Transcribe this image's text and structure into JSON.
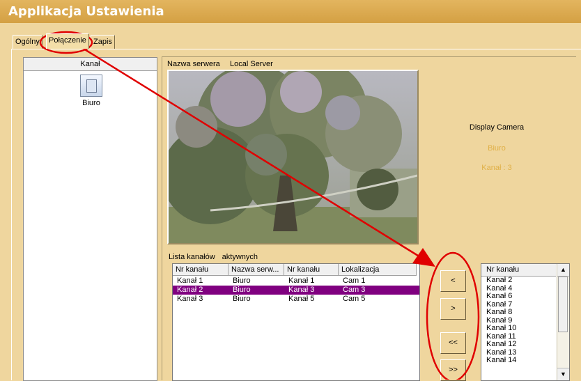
{
  "window": {
    "title": "Applikacja Ustawienia"
  },
  "tabs": [
    {
      "label": "Ogólny"
    },
    {
      "label": "Połączenie",
      "active": true
    },
    {
      "label": "Zapis"
    }
  ],
  "left_panel": {
    "header": "Kanał",
    "servers": [
      {
        "label": "Biuro",
        "icon": "server-icon"
      }
    ]
  },
  "server": {
    "label": "Nazwa serwera",
    "value": "Local Server"
  },
  "display": {
    "caption": "Display Camera",
    "camera_name": "Biuro",
    "channel": "Kanał : 3",
    "accent_color": "#e0b047"
  },
  "active_list": {
    "label_1": "Lista kanałów",
    "label_2": "aktywnych",
    "columns": [
      "Nr kanału",
      "Nazwa serw...",
      "Nr kanału",
      "Lokalizacja"
    ],
    "rows": [
      [
        "Kanał  1",
        "Biuro",
        "Kanał  1",
        "Cam 1"
      ],
      [
        "Kanał  2",
        "Biuro",
        "Kanał  3",
        "Cam 3"
      ],
      [
        "Kanał  3",
        "Biuro",
        "Kanał  5",
        "Cam 5"
      ]
    ],
    "selected_row": 1,
    "selection_color": "#800080"
  },
  "buttons": {
    "move_left": "<",
    "move_right": ">",
    "all_left": "<<",
    "all_right": ">>"
  },
  "available_list": {
    "header": "Nr kanału",
    "items": [
      "Kanał  2",
      "Kanał  4",
      "Kanał  6",
      "Kanał  7",
      "Kanał  8",
      "Kanał  9",
      "Kanał  10",
      "Kanał  11",
      "Kanał  12",
      "Kanał  13",
      "Kanał  14"
    ]
  },
  "annotation_color": "#e00000"
}
